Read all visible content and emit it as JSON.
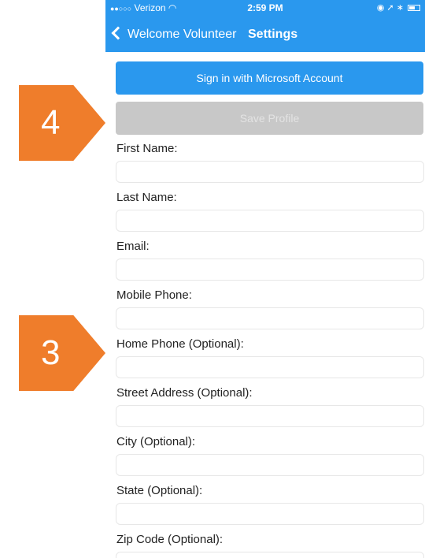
{
  "status_bar": {
    "signal": "●●○○○",
    "carrier": "Verizon",
    "time": "2:59 PM",
    "right_icons": "◉ ➚ ∗"
  },
  "nav": {
    "back_label": "Welcome Volunteer",
    "title": "Settings",
    "bar_color": "#2a98ee"
  },
  "buttons": {
    "sign_in": "Sign in with Microsoft Account",
    "save_profile": "Save Profile"
  },
  "form": {
    "fields": [
      {
        "label": "First Name:",
        "value": ""
      },
      {
        "label": "Last Name:",
        "value": ""
      },
      {
        "label": "Email:",
        "value": ""
      },
      {
        "label": "Mobile Phone:",
        "value": ""
      },
      {
        "label": "Home Phone (Optional):",
        "value": ""
      },
      {
        "label": "Street Address (Optional):",
        "value": ""
      },
      {
        "label": "City (Optional):",
        "value": ""
      },
      {
        "label": "State (Optional):",
        "value": ""
      },
      {
        "label": "Zip Code (Optional):",
        "value": ""
      }
    ]
  },
  "markers": {
    "step_4": "4",
    "step_3": "3",
    "color": "#ef7d2b"
  }
}
